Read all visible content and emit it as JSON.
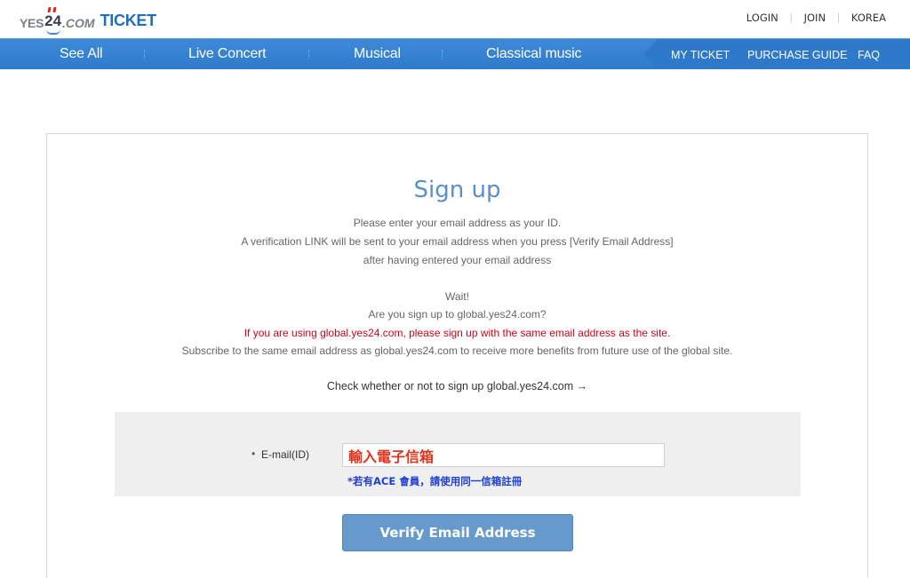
{
  "brand": {
    "logo_yes": "YES",
    "logo_24": "24",
    "logo_com": ".COM",
    "logo_ticket": "TICKET"
  },
  "top_links": [
    "LOGIN",
    "JOIN",
    "KOREA"
  ],
  "nav": {
    "main": [
      "See All",
      "Live Concert",
      "Musical",
      "Classical music"
    ],
    "right": [
      "MY TICKET",
      "PURCHASE GUIDE",
      "FAQ"
    ]
  },
  "signup": {
    "title": "Sign up",
    "intro": [
      "Please enter your email address as your ID.",
      "A verification LINK will be sent to your email address when you press [Verify Email Address]",
      "after having entered your email address"
    ],
    "wait": "Wait!",
    "question": "Are you sign up to global.yes24.com?",
    "warning": "If you are using global.yes24.com, please sign up with the same email address as the site.",
    "subscribe": "Subscribe to the same email address as global.yes24.com to receive more benefits from future use of the global site.",
    "check_link": "Check whether or not to sign up global.yes24.com →",
    "form": {
      "bullet": "•",
      "email_label": "E-mail(ID)",
      "email_value": "輸入電子信箱",
      "note": "*若有ACE 會員，請使用同一信箱註冊"
    },
    "verify_button": "Verify Email Address"
  },
  "colors": {
    "nav_blue": "#2f7acb",
    "title_blue": "#5a8fc8",
    "warning_red": "#d0021b",
    "note_blue": "#1d3fd6",
    "button_blue": "#6699cc"
  }
}
